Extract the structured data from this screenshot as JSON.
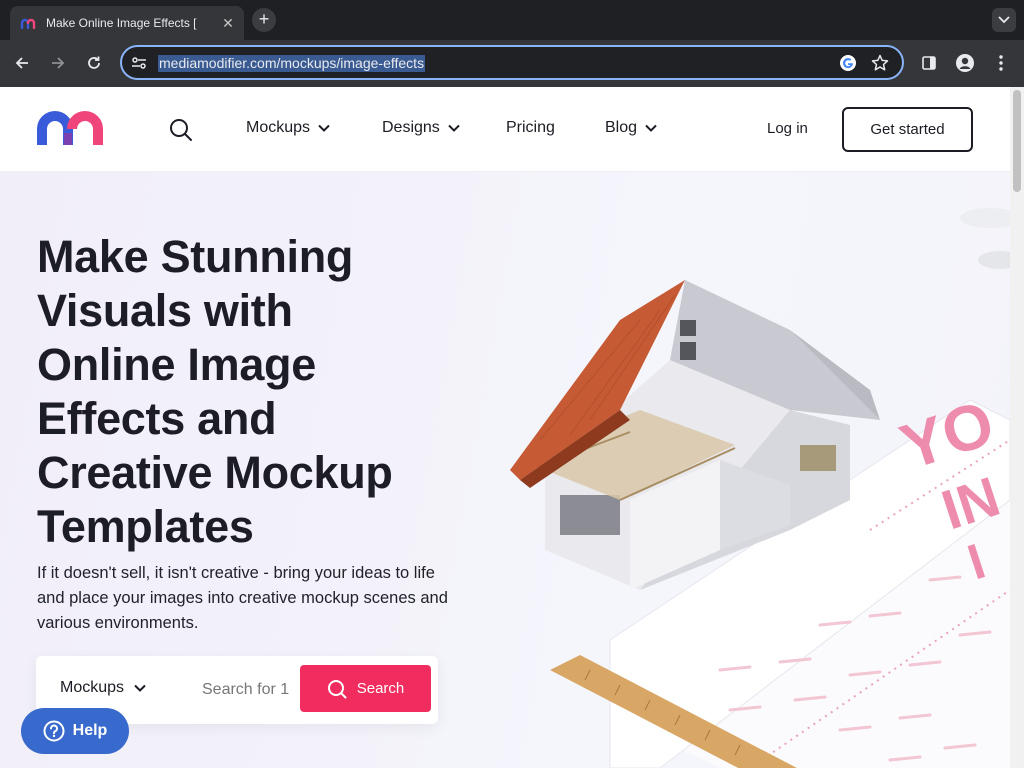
{
  "browser": {
    "tab_title": "Make Online Image Effects [",
    "url": "mediamodifier.com/mockups/image-effects"
  },
  "header": {
    "nav": {
      "mockups": "Mockups",
      "designs": "Designs",
      "pricing": "Pricing",
      "blog": "Blog"
    },
    "login": "Log in",
    "get_started": "Get started"
  },
  "hero": {
    "title_lines": [
      "Make Stunning",
      "Visuals with",
      "Online Image",
      "Effects and",
      "Creative Mockup",
      "Templates"
    ],
    "subtitle": "If it doesn't sell, it isn't creative - bring your ideas to life and place your images into creative mockup scenes and various environments.",
    "search": {
      "category": "Mockups",
      "placeholder": "Search for 1",
      "button": "Search"
    }
  },
  "help": {
    "label": "Help"
  },
  "illustration": {
    "paper_text": "YO IN I"
  },
  "colors": {
    "accent": "#f02d5e",
    "help": "#3869cc",
    "logo_blue": "#3a5bd9",
    "logo_pink": "#f0457a"
  }
}
